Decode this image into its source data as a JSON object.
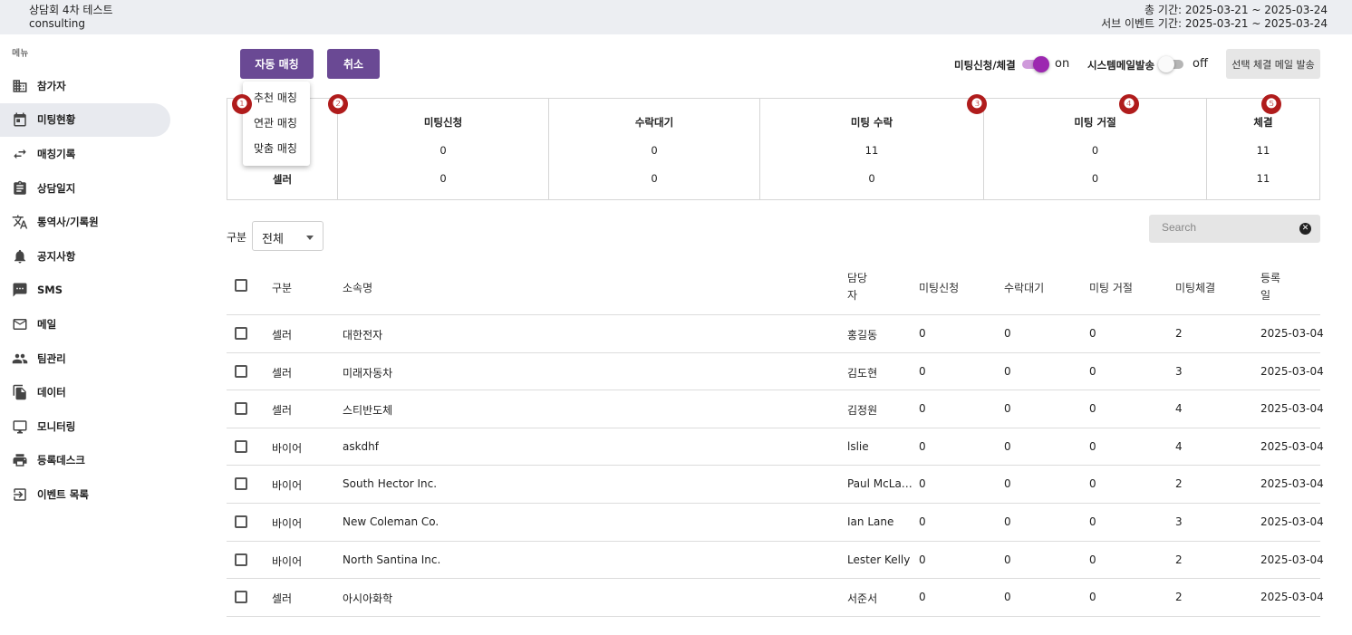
{
  "header": {
    "event_name": "상담회 4차 테스트",
    "event_sub": "consulting",
    "total_period": "총 기간: 2025-03-21 ~ 2025-03-24",
    "sub_period": "서브 이벤트 기간: 2025-03-21 ~ 2025-03-24"
  },
  "sidebar": {
    "menu_label": "메뉴",
    "items": [
      {
        "label": "참가자",
        "icon": "building-icon"
      },
      {
        "label": "미팅현황",
        "icon": "calendar-icon",
        "active": true
      },
      {
        "label": "매칭기록",
        "icon": "swap-arrows-icon"
      },
      {
        "label": "상담일지",
        "icon": "clipboard-icon"
      },
      {
        "label": "통역사/기록원",
        "icon": "translate-icon"
      },
      {
        "label": "공지사항",
        "icon": "bell-icon"
      },
      {
        "label": "SMS",
        "icon": "sms-icon"
      },
      {
        "label": "메일",
        "icon": "mail-icon"
      },
      {
        "label": "팀관리",
        "icon": "people-icon"
      },
      {
        "label": "데이터",
        "icon": "files-icon"
      },
      {
        "label": "모니터링",
        "icon": "monitor-icon"
      },
      {
        "label": "등록데스크",
        "icon": "printer-icon"
      },
      {
        "label": "이벤트 목록",
        "icon": "login-icon"
      }
    ]
  },
  "toolbar": {
    "auto_match": "자동 매칭",
    "cancel": "취소",
    "meeting_toggle_label": "미팅신청/체결",
    "meeting_toggle_state": "on",
    "mail_toggle_label": "시스템메일발송",
    "mail_toggle_state": "off",
    "send_mail": "선택 체결 메일 발송",
    "accent_color": "#6a4994",
    "toggle_on_color": "#9c27b0"
  },
  "dropdown": {
    "items": [
      "추천 매칭",
      "연관 매칭",
      "맞춤 매칭"
    ]
  },
  "badges": [
    "❶",
    "❷",
    "❸",
    "❹",
    "❺"
  ],
  "summary": {
    "headers": [
      "미팅신청",
      "수락대기",
      "미팅 수락",
      "미팅 거절",
      "체결"
    ],
    "rows": [
      {
        "label": "",
        "values": [
          "0",
          "0",
          "11",
          "0",
          "11"
        ]
      },
      {
        "label": "셀러",
        "values": [
          "0",
          "0",
          "0",
          "0",
          "11"
        ]
      }
    ]
  },
  "filter": {
    "label": "구분",
    "value": "전체",
    "search_placeholder": "Search"
  },
  "table": {
    "headers": [
      "구분",
      "소속명",
      "담당\n자",
      "미팅신청",
      "수락대기",
      "미팅 거절",
      "미팅체결",
      "등록\n일"
    ],
    "rows": [
      [
        "셀러",
        "대한전자",
        "홍길동",
        "0",
        "0",
        "0",
        "2",
        "2025-03-04"
      ],
      [
        "셀러",
        "미래자동차",
        "김도현",
        "0",
        "0",
        "0",
        "3",
        "2025-03-04"
      ],
      [
        "셀러",
        "스티반도체",
        "김정원",
        "0",
        "0",
        "0",
        "4",
        "2025-03-04"
      ],
      [
        "바이어",
        "askdhf",
        "lslie",
        "0",
        "0",
        "0",
        "4",
        "2025-03-04"
      ],
      [
        "바이어",
        "South Hector Inc.",
        "Paul McLa…",
        "0",
        "0",
        "0",
        "2",
        "2025-03-04"
      ],
      [
        "바이어",
        "New Coleman Co.",
        "Ian Lane",
        "0",
        "0",
        "0",
        "3",
        "2025-03-04"
      ],
      [
        "바이어",
        "North Santina Inc.",
        "Lester Kelly",
        "0",
        "0",
        "0",
        "2",
        "2025-03-04"
      ],
      [
        "셀러",
        "아시아화학",
        "서준서",
        "0",
        "0",
        "0",
        "2",
        "2025-03-04"
      ]
    ]
  }
}
